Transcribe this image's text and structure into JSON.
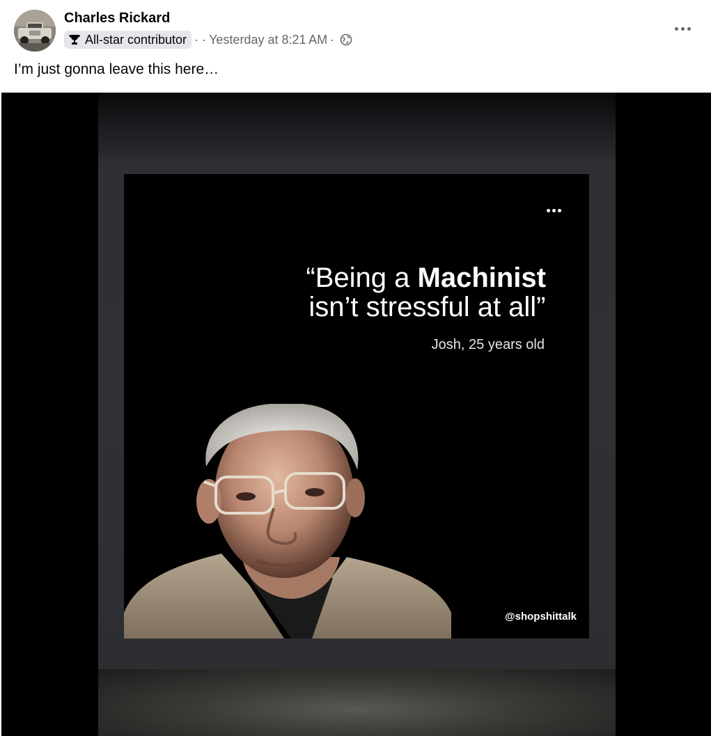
{
  "post": {
    "author": "Charles Rickard",
    "badge_label": "All-star contributor",
    "separator": "· ·",
    "timestamp": "Yesterday at 8:21 AM",
    "dot": "·",
    "audience_icon": "globe-icon",
    "more_icon": "more-options-icon",
    "text": "I’m just gonna leave this here…"
  },
  "meme": {
    "quote_line1_pre": "“Being a ",
    "quote_line1_bold": "Machinist",
    "quote_line2": "isn’t stressful at all”",
    "attribution": "Josh, 25 years old",
    "watermark": "@shopshittalk"
  },
  "colors": {
    "badge_bg": "#e4e6eb",
    "meta_text": "#65676b",
    "media_bg": "#000000"
  }
}
